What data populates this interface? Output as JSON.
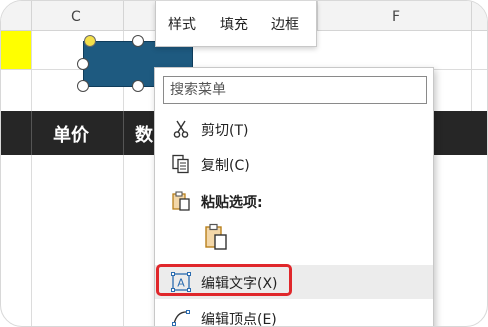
{
  "columns": [
    "C",
    "F"
  ],
  "header_row": {
    "cells": [
      "单价",
      "数"
    ]
  },
  "mini_toolbar": {
    "items": [
      "样式",
      "填充",
      "边框"
    ]
  },
  "context_menu": {
    "search_placeholder": "搜索菜单",
    "items": [
      {
        "label": "剪切(T)",
        "icon": "scissors-icon"
      },
      {
        "label": "复制(C)",
        "icon": "copy-icon"
      },
      {
        "label": "粘贴选项:",
        "icon": "paste-icon"
      },
      {
        "label": "编辑文字(X)",
        "icon": "edit-text-icon"
      },
      {
        "label": "编辑顶点(E)",
        "icon": "edit-points-icon"
      }
    ],
    "highlighted_item": "编辑文字(X)"
  },
  "colors": {
    "shape_fill": "#1e5a80",
    "header_fill": "#262626",
    "highlight_border": "#e0272b",
    "selected_cell": "#ffff00"
  }
}
